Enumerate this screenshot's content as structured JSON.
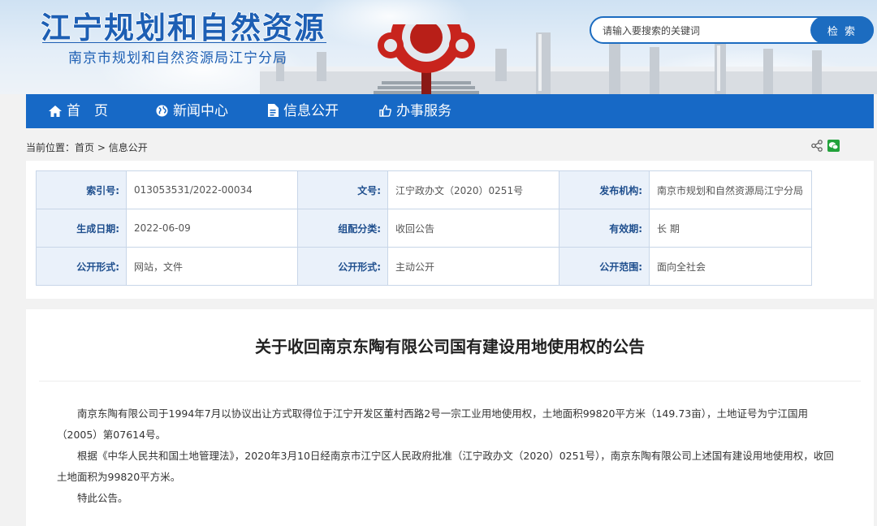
{
  "header": {
    "site_title": "江宁规划和自然资源",
    "site_subtitle": "南京市规划和自然资源局江宁分局",
    "search_placeholder": "请输入要搜索的关键词",
    "search_button": "检 索"
  },
  "nav": {
    "items": [
      {
        "label": "首　页",
        "icon": "home-icon"
      },
      {
        "label": "新闻中心",
        "icon": "globe-icon"
      },
      {
        "label": "信息公开",
        "icon": "document-icon"
      },
      {
        "label": "办事服务",
        "icon": "thumbs-up-icon"
      }
    ]
  },
  "breadcrumb": {
    "prefix": "当前位置：",
    "home": "首页",
    "separator": " > ",
    "current": "信息公开"
  },
  "meta": {
    "rows": [
      [
        {
          "label": "索引号:",
          "value": "013053531/2022-00034"
        },
        {
          "label": "文号:",
          "value": "江宁政办文（2020）0251号"
        },
        {
          "label": "发布机构:",
          "value": "南京市规划和自然资源局江宁分局"
        }
      ],
      [
        {
          "label": "生成日期:",
          "value": "2022-06-09"
        },
        {
          "label": "组配分类:",
          "value": "收回公告"
        },
        {
          "label": "有效期:",
          "value": "长 期"
        }
      ],
      [
        {
          "label": "公开形式:",
          "value": "网站，文件"
        },
        {
          "label": "公开形式:",
          "value": "主动公开"
        },
        {
          "label": "公开范围:",
          "value": "面向全社会"
        }
      ]
    ]
  },
  "article": {
    "title": "关于收回南京东陶有限公司国有建设用地使用权的公告",
    "paragraphs": [
      "南京东陶有限公司于1994年7月以协议出让方式取得位于江宁开发区董村西路2号一宗工业用地使用权，土地面积99820平方米（149.73亩），土地证号为宁江国用（2005）第07614号。",
      "根据《中华人民共和国土地管理法》，2020年3月10日经南京市江宁区人民政府批准（江宁政办文（2020）0251号），南京东陶有限公司上述国有建设用地使用权，收回土地面积为99820平方米。",
      "特此公告。"
    ]
  },
  "colors": {
    "brand_blue": "#1769c6",
    "title_blue": "#1d5fb4",
    "label_bg": "#eaf1fa",
    "wechat_green": "#22a23b"
  }
}
